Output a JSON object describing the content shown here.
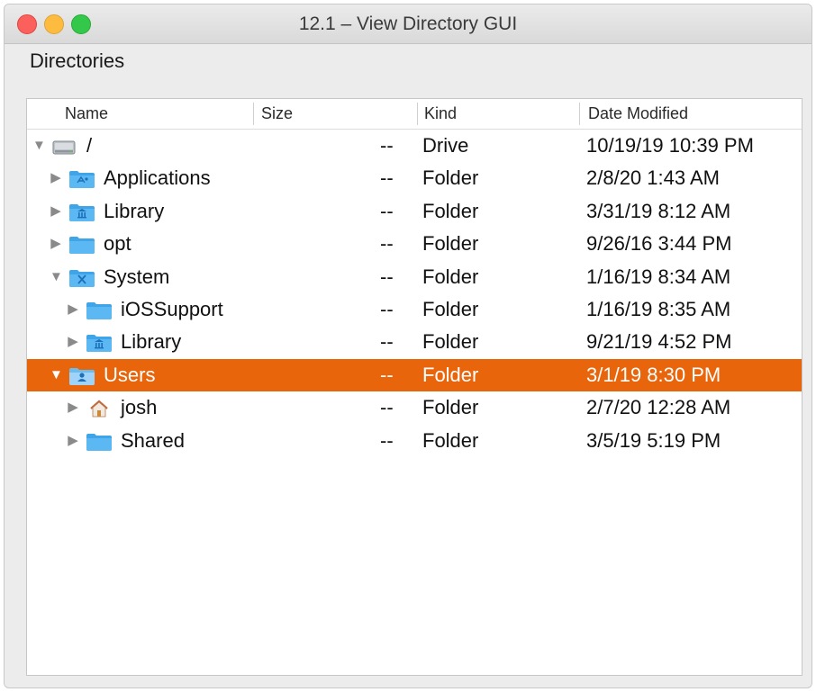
{
  "window": {
    "title": "12.1 – View Directory GUI",
    "accent_color": "#e8650c"
  },
  "section_label": "Directories",
  "columns": {
    "name": "Name",
    "size": "Size",
    "kind": "Kind",
    "date": "Date Modified"
  },
  "rows": [
    {
      "name": "/",
      "size": "--",
      "kind": "Drive",
      "date": "10/19/19 10:39 PM",
      "icon": "drive-icon",
      "expanded": true,
      "selected": false
    },
    {
      "name": "Applications",
      "size": "--",
      "kind": "Folder",
      "date": "2/8/20 1:43 AM",
      "icon": "applications-folder-icon",
      "expanded": false,
      "selected": false
    },
    {
      "name": "Library",
      "size": "--",
      "kind": "Folder",
      "date": "3/31/19 8:12 AM",
      "icon": "library-folder-icon",
      "expanded": false,
      "selected": false
    },
    {
      "name": "opt",
      "size": "--",
      "kind": "Folder",
      "date": "9/26/16 3:44 PM",
      "icon": "folder-icon",
      "expanded": false,
      "selected": false
    },
    {
      "name": "System",
      "size": "--",
      "kind": "Folder",
      "date": "1/16/19 8:34 AM",
      "icon": "system-folder-icon",
      "expanded": true,
      "selected": false
    },
    {
      "name": "iOSSupport",
      "size": "--",
      "kind": "Folder",
      "date": "1/16/19 8:35 AM",
      "icon": "folder-icon",
      "expanded": false,
      "selected": false
    },
    {
      "name": "Library",
      "size": "--",
      "kind": "Folder",
      "date": "9/21/19 4:52 PM",
      "icon": "library-folder-icon",
      "expanded": false,
      "selected": false
    },
    {
      "name": "Users",
      "size": "--",
      "kind": "Folder",
      "date": "3/1/19 8:30 PM",
      "icon": "users-folder-icon",
      "expanded": true,
      "selected": true
    },
    {
      "name": "josh",
      "size": "--",
      "kind": "Folder",
      "date": "2/7/20 12:28 AM",
      "icon": "home-icon",
      "expanded": false,
      "selected": false
    },
    {
      "name": "Shared",
      "size": "--",
      "kind": "Folder",
      "date": "3/5/19 5:19 PM",
      "icon": "folder-icon",
      "expanded": false,
      "selected": false
    }
  ]
}
